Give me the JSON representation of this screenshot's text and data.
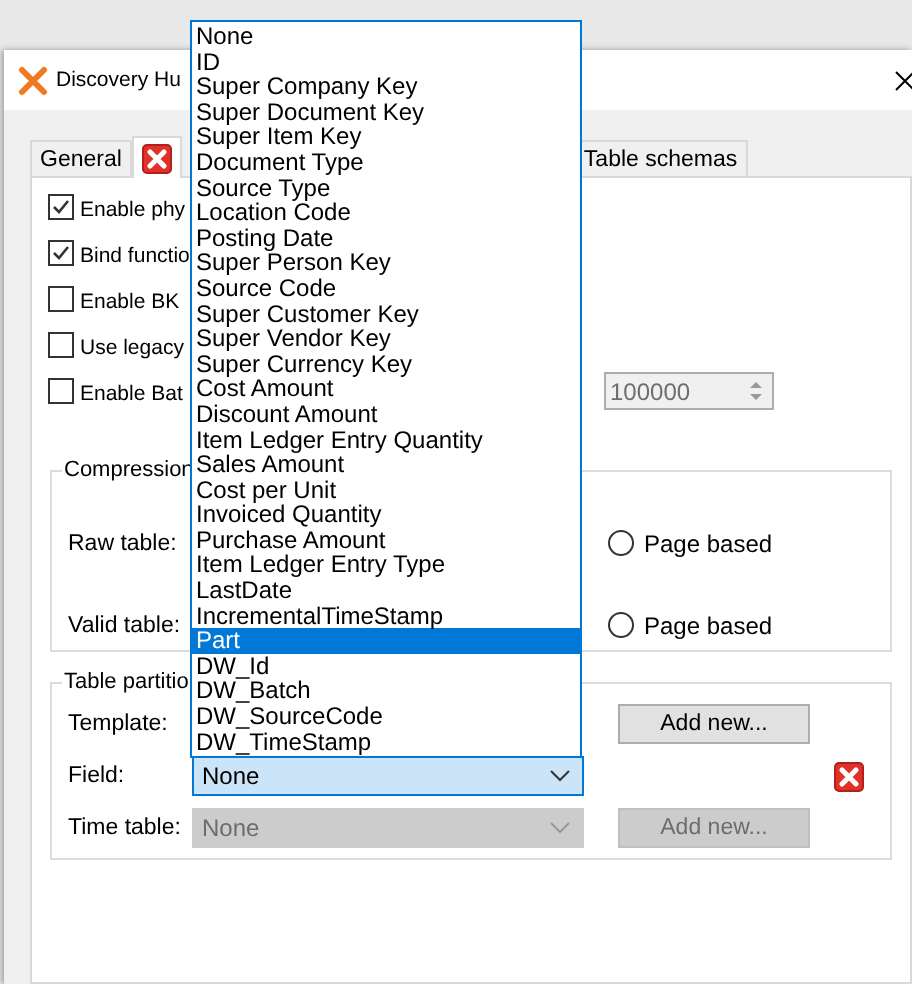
{
  "window": {
    "title": "Discovery Hu"
  },
  "tabs": [
    {
      "kind": "text",
      "label": "General",
      "selected": false
    },
    {
      "kind": "error",
      "selected": true
    },
    {
      "kind": "text",
      "label": "Table schemas",
      "selected": false
    }
  ],
  "options": [
    {
      "label": "Enable phy",
      "checked": true
    },
    {
      "label": "Bind functio",
      "checked": true
    },
    {
      "label": "Enable BK",
      "checked": false
    },
    {
      "label": "Use legacy",
      "checked": false
    },
    {
      "label": "Enable Bat",
      "checked": false
    }
  ],
  "batch_size": {
    "value": "100000",
    "disabled": true
  },
  "compression": {
    "title": "Compression",
    "rows": [
      {
        "label": "Raw table:",
        "option": "Page based",
        "selected": false
      },
      {
        "label": "Valid table:",
        "option": "Page based",
        "selected": false
      }
    ]
  },
  "partition": {
    "title": "Table partitio",
    "template": {
      "label": "Template:",
      "button": "Add new...",
      "disabled": false
    },
    "field": {
      "label": "Field:",
      "value": "None",
      "focused": true,
      "error": true
    },
    "time_table": {
      "label": "Time table:",
      "value": "None",
      "button": "Add new...",
      "disabled": true
    }
  },
  "dropdown": {
    "items": [
      {
        "label": "None",
        "selected": false
      },
      {
        "label": "ID",
        "selected": false
      },
      {
        "label": "Super Company Key",
        "selected": false
      },
      {
        "label": "Super Document Key",
        "selected": false
      },
      {
        "label": "Super Item Key",
        "selected": false
      },
      {
        "label": "Document Type",
        "selected": false
      },
      {
        "label": "Source Type",
        "selected": false
      },
      {
        "label": "Location Code",
        "selected": false
      },
      {
        "label": "Posting Date",
        "selected": false
      },
      {
        "label": "Super Person Key",
        "selected": false
      },
      {
        "label": "Source Code",
        "selected": false
      },
      {
        "label": "Super Customer Key",
        "selected": false
      },
      {
        "label": "Super Vendor Key",
        "selected": false
      },
      {
        "label": "Super Currency Key",
        "selected": false
      },
      {
        "label": "Cost Amount",
        "selected": false
      },
      {
        "label": "Discount Amount",
        "selected": false
      },
      {
        "label": "Item Ledger Entry Quantity",
        "selected": false
      },
      {
        "label": "Sales Amount",
        "selected": false
      },
      {
        "label": "Cost per Unit",
        "selected": false
      },
      {
        "label": "Invoiced Quantity",
        "selected": false
      },
      {
        "label": "Purchase Amount",
        "selected": false
      },
      {
        "label": "Item Ledger Entry Type",
        "selected": false
      },
      {
        "label": "LastDate",
        "selected": false
      },
      {
        "label": "IncrementalTimeStamp",
        "selected": false
      },
      {
        "label": "Part",
        "selected": true
      },
      {
        "label": "DW_Id",
        "selected": false
      },
      {
        "label": "DW_Batch",
        "selected": false
      },
      {
        "label": "DW_SourceCode",
        "selected": false
      },
      {
        "label": "DW_TimeStamp",
        "selected": false
      }
    ]
  }
}
